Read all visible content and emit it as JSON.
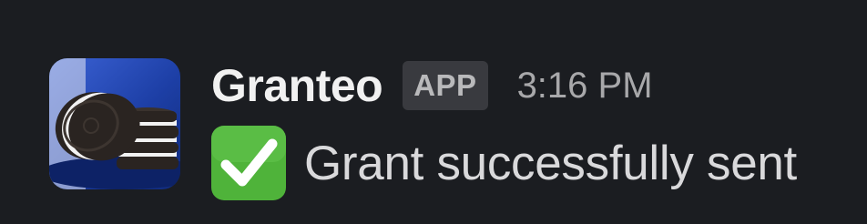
{
  "message": {
    "avatar": {
      "icon": "oreo-cookies-avatar-icon",
      "colors": {
        "background": "#1d3fa6",
        "cookie": "#2a2421",
        "cream": "#f2f2f2"
      }
    },
    "sender": "Granteo",
    "badge": "APP",
    "timestamp": "3:16 PM",
    "emoji": {
      "icon": "white-check-mark-icon",
      "color": "#4fb33a"
    },
    "text": "Grant successfully sent"
  }
}
